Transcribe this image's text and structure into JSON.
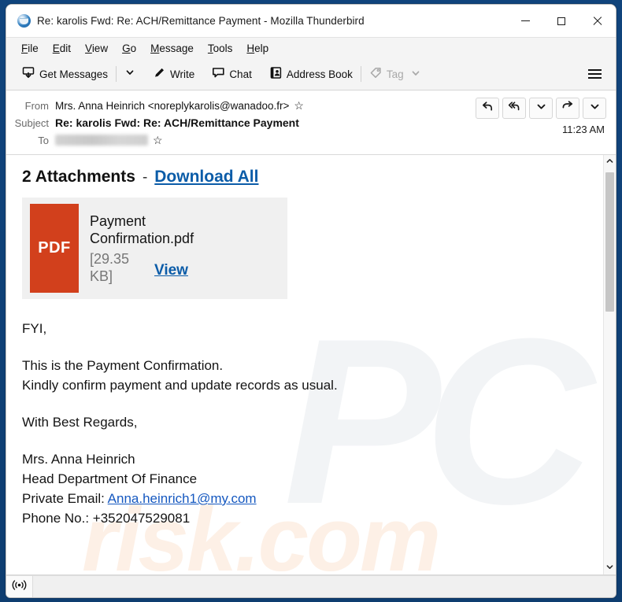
{
  "window": {
    "title": "Re: karolis Fwd: Re: ACH/Remittance Payment - Mozilla Thunderbird",
    "logo_icon": "thunderbird-logo-icon",
    "controls": {
      "minimize": "minimize-icon",
      "maximize": "maximize-icon",
      "close": "close-icon"
    }
  },
  "menubar": {
    "items": [
      {
        "label": "File",
        "accesskey": "F"
      },
      {
        "label": "Edit",
        "accesskey": "E"
      },
      {
        "label": "View",
        "accesskey": "V"
      },
      {
        "label": "Go",
        "accesskey": "G"
      },
      {
        "label": "Message",
        "accesskey": "M"
      },
      {
        "label": "Tools",
        "accesskey": "T"
      },
      {
        "label": "Help",
        "accesskey": "H"
      }
    ]
  },
  "toolbar": {
    "get_messages": "Get Messages",
    "get_messages_icon": "get-messages-icon",
    "get_messages_caret": "chevron-down-icon",
    "write": "Write",
    "write_icon": "pencil-icon",
    "chat": "Chat",
    "chat_icon": "speech-bubble-icon",
    "address_book": "Address Book",
    "address_book_icon": "address-book-icon",
    "tag": "Tag",
    "tag_icon": "tag-icon",
    "tag_caret": "chevron-down-icon",
    "tag_disabled": true,
    "app_menu_icon": "hamburger-menu-icon"
  },
  "message_header": {
    "from_label": "From",
    "from_value": "Mrs. Anna Heinrich <noreplykarolis@wanadoo.fr>",
    "from_star_icon": "star-icon",
    "subject_label": "Subject",
    "subject_value": "Re: karolis Fwd: Re: ACH/Remittance Payment",
    "to_label": "To",
    "to_value": "",
    "to_redacted": true,
    "to_star_icon": "star-icon",
    "time": "11:23 AM",
    "actions": [
      {
        "name": "reply-button",
        "icon": "reply-icon"
      },
      {
        "name": "reply-all-button",
        "icon": "reply-all-icon"
      },
      {
        "name": "reply-more-button",
        "icon": "chevron-down-icon"
      },
      {
        "name": "forward-button",
        "icon": "forward-icon"
      },
      {
        "name": "more-actions-button",
        "icon": "chevron-down-icon"
      }
    ]
  },
  "attachments": {
    "count_label": "2 Attachments",
    "separator": "-",
    "download_all_label": "Download All",
    "items": [
      {
        "filetype_badge": "PDF",
        "filename": "Payment Confirmation.pdf",
        "size": "[29.35 KB]",
        "view_label": "View",
        "badge_color": "#d2401c"
      }
    ]
  },
  "mail_body": {
    "greeting": "FYI,",
    "line1": "This is the Payment Confirmation.",
    "line2": "Kindly confirm payment and update records as usual.",
    "closing": "With Best Regards,",
    "sig_name": "Mrs. Anna Heinrich",
    "sig_title": "Head Department Of Finance",
    "sig_email_label": "Private Email:",
    "sig_email": "Anna.heinrich1@my.com",
    "sig_phone": "Phone No.:  +352047529081"
  },
  "watermark": {
    "mark1": "PC",
    "mark2": "risk.com"
  },
  "scrollbar": {
    "up_icon": "chevron-up-icon",
    "down_icon": "chevron-down-icon"
  },
  "statusbar": {
    "connection_icon": "online-status-icon",
    "text": ""
  },
  "colors": {
    "link": "#0b5ca8",
    "body_link": "#1558c0",
    "pdf_badge": "#d2401c",
    "window_border": "#10447c",
    "toolbar_bg": "#f4f4f4"
  }
}
